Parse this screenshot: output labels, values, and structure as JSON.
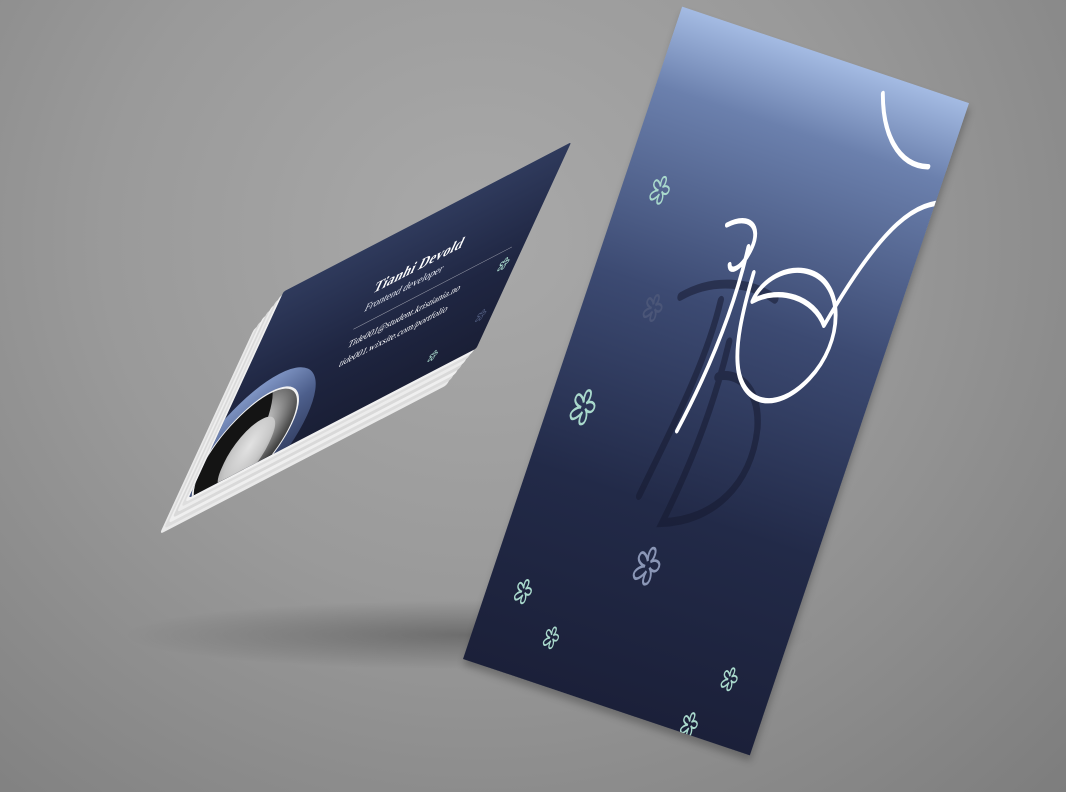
{
  "card_front": {
    "name": "Tianhi Devold",
    "role": "Frontend developer",
    "email": "Tide001@student.kristiania.no",
    "website": "tide001.wixsite.com/portfolio"
  },
  "card_back": {
    "monogram": "TD"
  },
  "colors": {
    "background": "#9a9a9a",
    "card_navy": "#1f2642",
    "card_light_blue": "#a4bbe3",
    "flower_mint": "#a9d9cc",
    "flower_dim": "#4b5678"
  },
  "icons": [
    "flower-icon"
  ]
}
